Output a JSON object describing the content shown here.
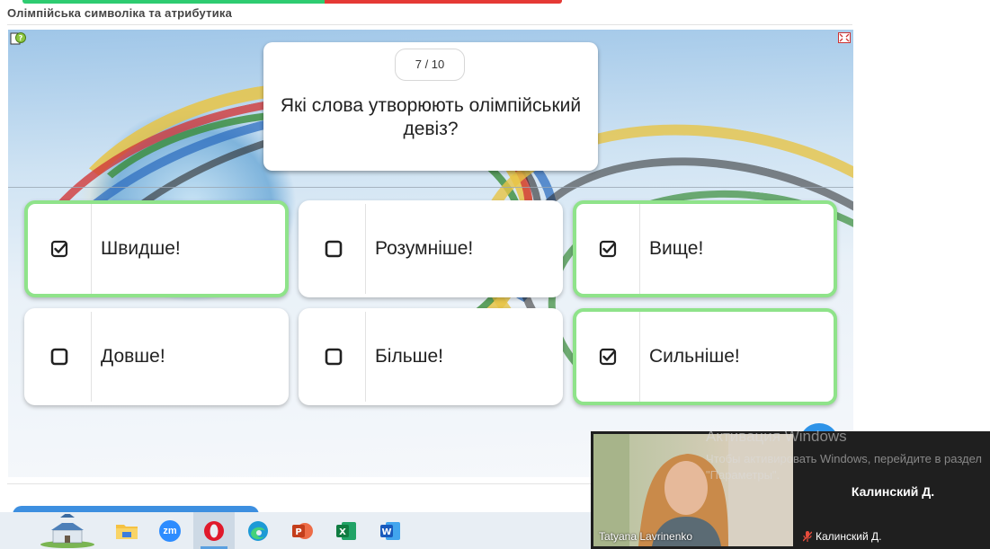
{
  "page": {
    "title": "Олімпійська символіка та атрибутика"
  },
  "quiz": {
    "progress": "7 / 10",
    "progress_fraction": 0.7,
    "question": "Які слова утворюють олімпійський девіз?",
    "answers": [
      {
        "label": "Швидше!",
        "selected": true
      },
      {
        "label": "Розумніше!",
        "selected": false
      },
      {
        "label": "Вище!",
        "selected": true
      },
      {
        "label": "Довше!",
        "selected": false
      },
      {
        "label": "Більше!",
        "selected": false
      },
      {
        "label": "Сильніше!",
        "selected": true
      }
    ]
  },
  "taskbar": {
    "apps": [
      "castle-icon",
      "file-explorer-icon",
      "zoom-icon",
      "opera-icon",
      "edge-icon",
      "powerpoint-icon",
      "excel-icon",
      "word-icon"
    ],
    "zoom_label": "zm"
  },
  "video_call": {
    "left_participant": "Tatyana Lavrinenko",
    "right_participant_name": "Калинский Д.",
    "right_participant_label": "Калинский Д."
  },
  "windows_activation": {
    "title": "Активация Windows",
    "message": "Чтобы активировать Windows, перейдите в раздел \"Параметры\"."
  },
  "colors": {
    "selected_border": "#8fe38a",
    "progress_done": "#2ecc71",
    "progress_remaining": "#e53935",
    "primary_blue": "#3d8fe0"
  }
}
